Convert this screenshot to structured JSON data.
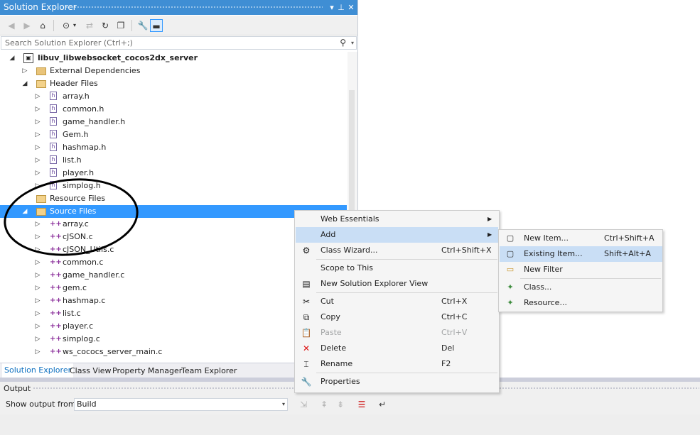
{
  "solution_explorer": {
    "title": "Solution Explorer",
    "title_buttons": {
      "dropdown": "▾",
      "pin": "⊥",
      "close": "✕"
    },
    "search_placeholder": "Search Solution Explorer (Ctrl+;)",
    "tree": [
      {
        "label": "libuv_libwebsocket_cocos2dx_server",
        "icon": "project-icon",
        "level": 1,
        "expanded": true,
        "bold": true
      },
      {
        "label": "External Dependencies",
        "icon": "folder-icon",
        "level": 2,
        "expanded": false
      },
      {
        "label": "Header Files",
        "icon": "filter-folder-icon",
        "level": 2,
        "expanded": true
      },
      {
        "label": "array.h",
        "icon": "header-file-icon",
        "level": 3,
        "expanded": false
      },
      {
        "label": "common.h",
        "icon": "header-file-icon",
        "level": 3,
        "expanded": false
      },
      {
        "label": "game_handler.h",
        "icon": "header-file-icon",
        "level": 3,
        "expanded": false
      },
      {
        "label": "Gem.h",
        "icon": "header-file-icon",
        "level": 3,
        "expanded": false
      },
      {
        "label": "hashmap.h",
        "icon": "header-file-icon",
        "level": 3,
        "expanded": false
      },
      {
        "label": "list.h",
        "icon": "header-file-icon",
        "level": 3,
        "expanded": false
      },
      {
        "label": "player.h",
        "icon": "header-file-icon",
        "level": 3,
        "expanded": false
      },
      {
        "label": "simplog.h",
        "icon": "header-file-icon",
        "level": 3,
        "expanded": false
      },
      {
        "label": "Resource Files",
        "icon": "filter-folder-icon",
        "level": 2,
        "expanded": null
      },
      {
        "label": "Source Files",
        "icon": "filter-folder-icon",
        "level": 2,
        "expanded": true,
        "selected": true
      },
      {
        "label": "array.c",
        "icon": "c-source-file-icon",
        "level": 3,
        "expanded": false
      },
      {
        "label": "cJSON.c",
        "icon": "c-source-file-icon",
        "level": 3,
        "expanded": false
      },
      {
        "label": "cJSON_Utils.c",
        "icon": "c-source-file-icon",
        "level": 3,
        "expanded": false
      },
      {
        "label": "common.c",
        "icon": "c-source-file-icon",
        "level": 3,
        "expanded": false
      },
      {
        "label": "game_handler.c",
        "icon": "c-source-file-icon",
        "level": 3,
        "expanded": false
      },
      {
        "label": "gem.c",
        "icon": "c-source-file-icon",
        "level": 3,
        "expanded": false
      },
      {
        "label": "hashmap.c",
        "icon": "c-source-file-icon",
        "level": 3,
        "expanded": false
      },
      {
        "label": "list.c",
        "icon": "c-source-file-icon",
        "level": 3,
        "expanded": false
      },
      {
        "label": "player.c",
        "icon": "c-source-file-icon",
        "level": 3,
        "expanded": false
      },
      {
        "label": "simplog.c",
        "icon": "c-source-file-icon",
        "level": 3,
        "expanded": false
      },
      {
        "label": "ws_cococs_server_main.c",
        "icon": "c-source-file-icon",
        "level": 3,
        "expanded": false
      }
    ],
    "tabs": [
      "Solution Explorer",
      "Class View",
      "Property Manager",
      "Team Explorer"
    ],
    "active_tab": 0
  },
  "output": {
    "title": "Output",
    "show_output_label": "Show output from:",
    "show_output_value": "Build"
  },
  "context_menu": {
    "items": [
      {
        "type": "item",
        "label": "Web Essentials",
        "shortcut": "",
        "submenu": true,
        "icon": ""
      },
      {
        "type": "item",
        "label": "Add",
        "shortcut": "",
        "submenu": true,
        "icon": "",
        "highlight": true
      },
      {
        "type": "item",
        "label": "Class Wizard...",
        "shortcut": "Ctrl+Shift+X",
        "icon": "class-wizard-icon"
      },
      {
        "type": "separator"
      },
      {
        "type": "item",
        "label": "Scope to This",
        "shortcut": "",
        "icon": ""
      },
      {
        "type": "item",
        "label": "New Solution Explorer View",
        "shortcut": "",
        "icon": "new-view-icon"
      },
      {
        "type": "separator"
      },
      {
        "type": "item",
        "label": "Cut",
        "shortcut": "Ctrl+X",
        "icon": "cut-icon"
      },
      {
        "type": "item",
        "label": "Copy",
        "shortcut": "Ctrl+C",
        "icon": "copy-icon"
      },
      {
        "type": "item",
        "label": "Paste",
        "shortcut": "Ctrl+V",
        "icon": "paste-icon",
        "disabled": true
      },
      {
        "type": "item",
        "label": "Delete",
        "shortcut": "Del",
        "icon": "delete-icon"
      },
      {
        "type": "item",
        "label": "Rename",
        "shortcut": "F2",
        "icon": "rename-icon"
      },
      {
        "type": "separator"
      },
      {
        "type": "item",
        "label": "Properties",
        "shortcut": "",
        "icon": "properties-icon"
      }
    ]
  },
  "submenu_add": {
    "items": [
      {
        "type": "item",
        "label": "New Item...",
        "shortcut": "Ctrl+Shift+A",
        "icon": "new-item-icon"
      },
      {
        "type": "item",
        "label": "Existing Item...",
        "shortcut": "Shift+Alt+A",
        "icon": "existing-item-icon",
        "highlight": true
      },
      {
        "type": "item",
        "label": "New Filter",
        "shortcut": "",
        "icon": "new-filter-icon"
      },
      {
        "type": "separator"
      },
      {
        "type": "item",
        "label": "Class...",
        "shortcut": "",
        "icon": "class-icon"
      },
      {
        "type": "item",
        "label": "Resource...",
        "shortcut": "",
        "icon": "resource-icon"
      }
    ]
  },
  "colors": {
    "title_bar": "#3f8ed4",
    "selection": "#3399ff",
    "menu_highlight": "#c9def5"
  }
}
